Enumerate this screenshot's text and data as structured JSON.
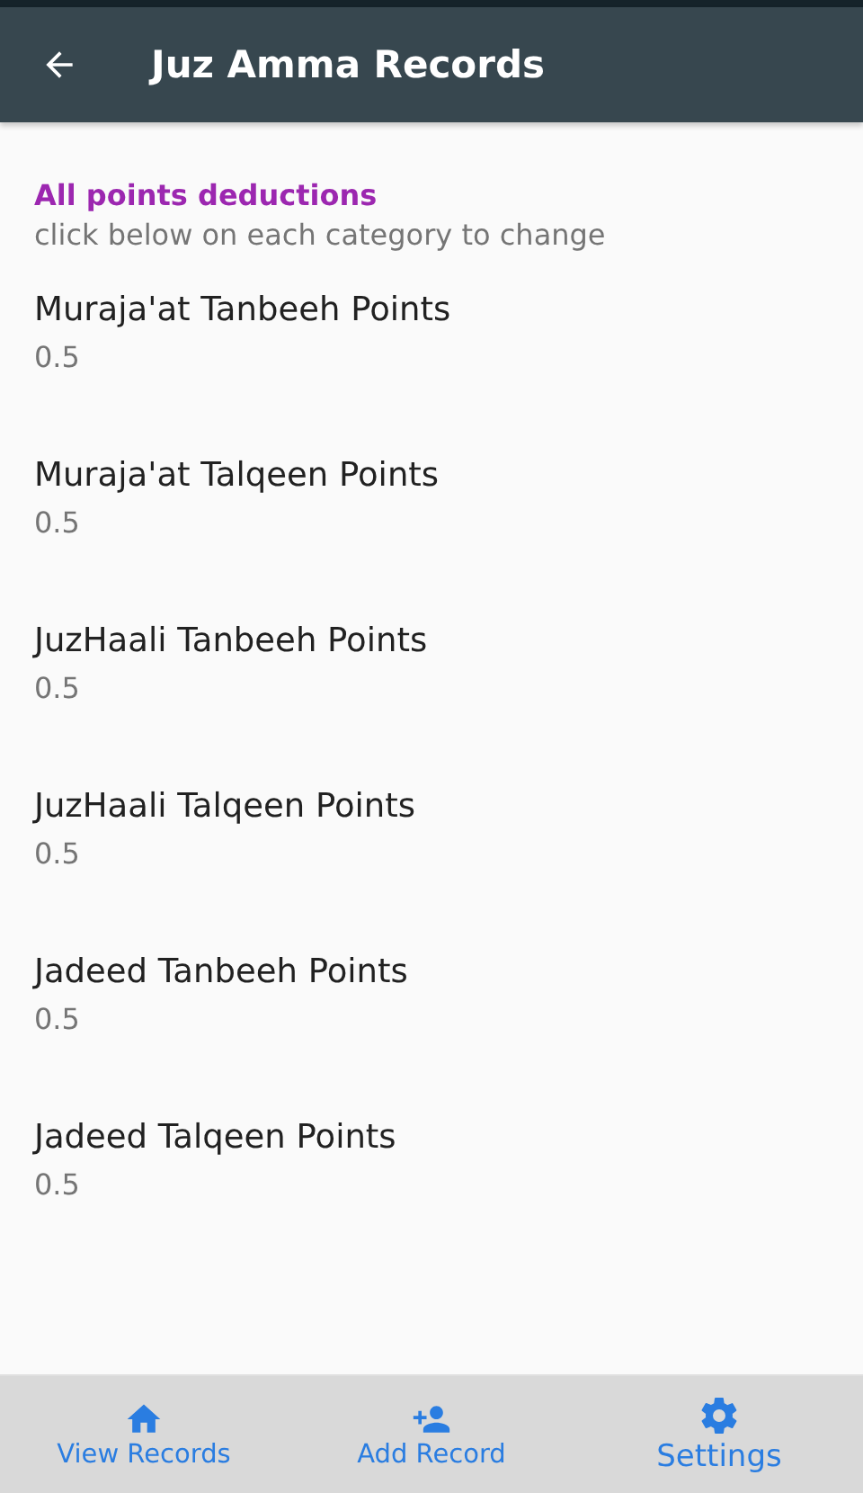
{
  "app_bar": {
    "title": "Juz Amma Records"
  },
  "section": {
    "title": "All points deductions",
    "subtitle": "click below on each category to change"
  },
  "settings": [
    {
      "name": "Muraja'at Tanbeeh Points",
      "value": "0.5"
    },
    {
      "name": "Muraja'at Talqeen Points",
      "value": "0.5"
    },
    {
      "name": "JuzHaali Tanbeeh Points",
      "value": "0.5"
    },
    {
      "name": "JuzHaali Talqeen Points",
      "value": "0.5"
    },
    {
      "name": "Jadeed Tanbeeh Points",
      "value": "0.5"
    },
    {
      "name": "Jadeed Talqeen Points",
      "value": "0.5"
    }
  ],
  "bottom_nav": [
    {
      "label": "View Records",
      "kind": "home",
      "selected": false
    },
    {
      "label": "Add Record",
      "kind": "add-person",
      "selected": false
    },
    {
      "label": "Settings",
      "kind": "settings",
      "selected": true
    }
  ]
}
